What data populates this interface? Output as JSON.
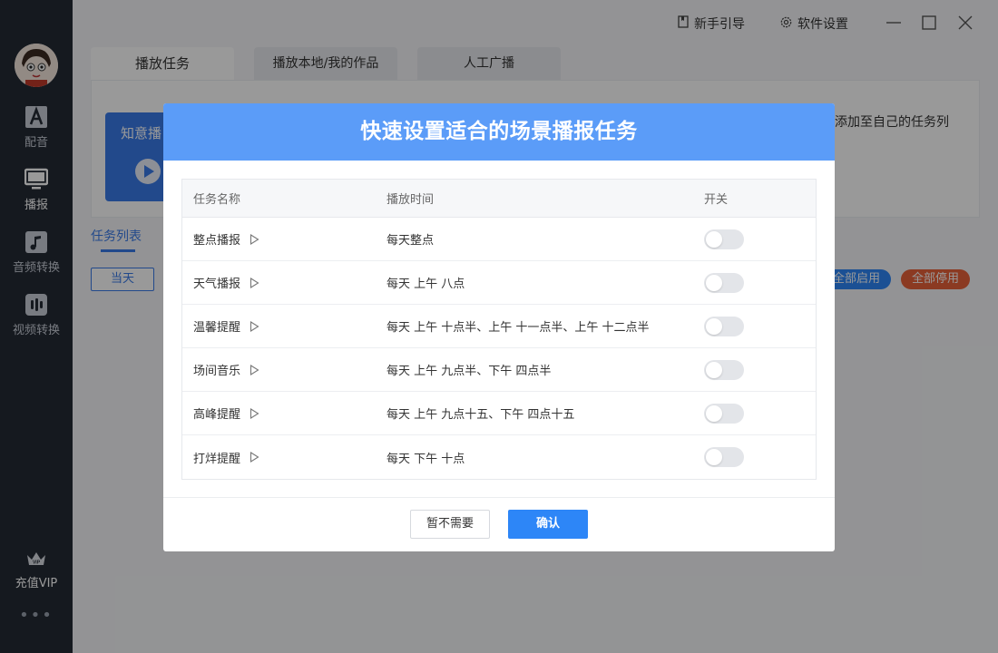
{
  "sidebar": {
    "items": [
      {
        "label": "配音",
        "icon": "text-a-icon"
      },
      {
        "label": "播报",
        "icon": "monitor-icon"
      },
      {
        "label": "音频转换",
        "icon": "music-note-icon"
      },
      {
        "label": "视频转换",
        "icon": "audio-bars-icon"
      }
    ],
    "vip_label": "充值VIP",
    "more_label": "•••"
  },
  "topbar": {
    "guide_label": "新手引导",
    "settings_label": "软件设置"
  },
  "tabs": [
    {
      "label": "播放任务"
    },
    {
      "label": "播放本地/我的作品"
    },
    {
      "label": "人工广播"
    }
  ],
  "background": {
    "banner_text": "知意播",
    "right_text": "添加至自己的任务列",
    "list_title": "任务列表",
    "today_label": "当天",
    "enable_all_label": "全部启用",
    "disable_all_label": "全部停用"
  },
  "modal": {
    "title": "快速设置适合的场景播报任务",
    "columns": [
      "任务名称",
      "播放时间",
      "开关"
    ],
    "rows": [
      {
        "name": "整点播报",
        "time": "每天整点",
        "enabled": false
      },
      {
        "name": "天气播报",
        "time": "每天 上午 八点",
        "enabled": false
      },
      {
        "name": "温馨提醒",
        "time": "每天 上午 十点半、上午 十一点半、上午 十二点半",
        "enabled": false
      },
      {
        "name": "场间音乐",
        "time": "每天 上午 九点半、下午 四点半",
        "enabled": false
      },
      {
        "name": "高峰提醒",
        "time": "每天 上午 九点十五、下午 四点十五",
        "enabled": false
      },
      {
        "name": "打烊提醒",
        "time": "每天 下午 十点",
        "enabled": false
      }
    ],
    "cancel_label": "暂不需要",
    "confirm_label": "确认"
  },
  "colors": {
    "accent": "#2d86f7",
    "header": "#5b9cf8",
    "sidebar": "#232a35",
    "enable_pill": "#2d86f7",
    "disable_pill": "#e8613a"
  }
}
